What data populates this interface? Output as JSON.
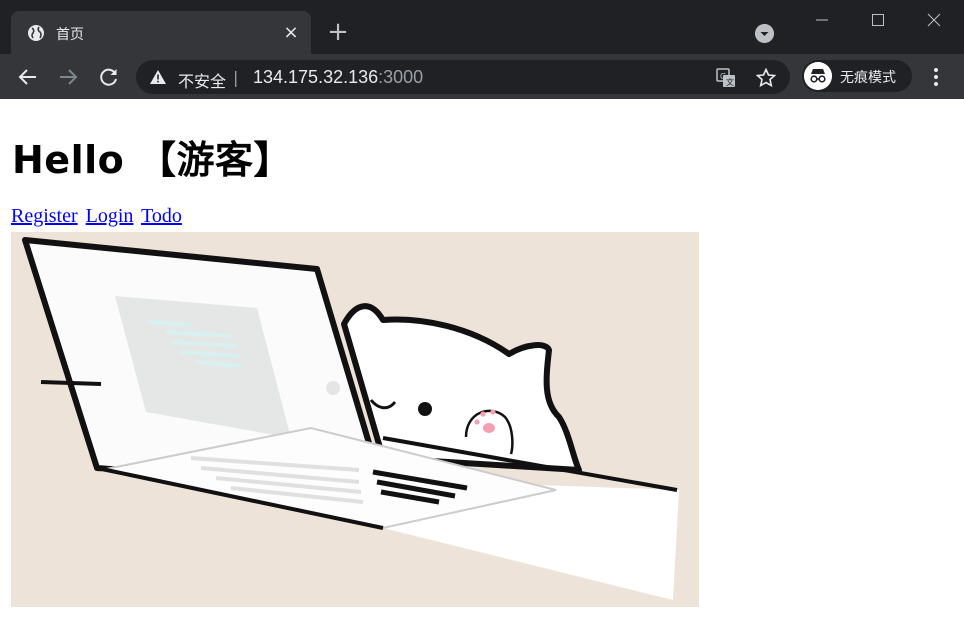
{
  "browser": {
    "tab": {
      "title": "首页",
      "favicon": "globe-icon",
      "close": "×"
    },
    "new_tab": "+",
    "omnibox": {
      "security_label": "不安全",
      "separator": "|",
      "url_host": "134.175.32.136",
      "url_port": ":3000"
    },
    "incognito_label": "无痕模式",
    "colors": {
      "frame": "#202124",
      "toolbar": "#35363a",
      "text": "#e8eaed"
    }
  },
  "page": {
    "greeting": "Hello 【游客】",
    "links": [
      {
        "label": "Register"
      },
      {
        "label": "Login"
      },
      {
        "label": "Todo"
      }
    ],
    "hero_image": "cat-typing-on-laptop-illustration",
    "colors": {
      "link": "#0000ee",
      "hero_bg": "#ede3d9"
    }
  }
}
